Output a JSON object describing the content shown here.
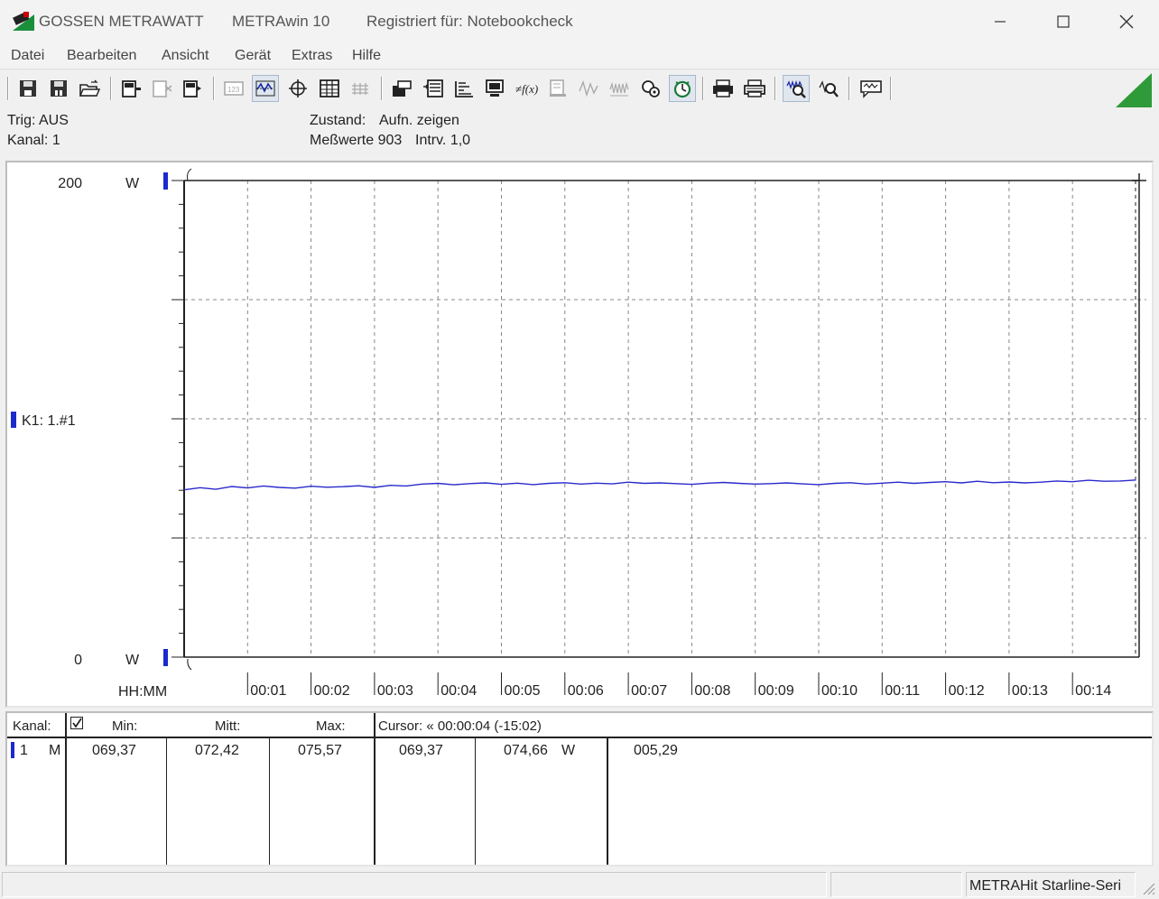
{
  "window": {
    "vendor": "GOSSEN METRAWATT",
    "app": "METRAwin 10",
    "registration": "Registriert für: Notebookcheck"
  },
  "menu": [
    "Datei",
    "Bearbeiten",
    "Ansicht",
    "Gerät",
    "Extras",
    "Hilfe"
  ],
  "status": {
    "trigger": "Trig: AUS",
    "channel": "Kanal: 1",
    "state_label": "Zustand:",
    "state_value": "Aufn. zeigen",
    "measurements": "Meßwerte 903",
    "interval": "Intrv. 1,0"
  },
  "chart_data": {
    "type": "line",
    "y_axis": {
      "max_label": "200",
      "min_label": "0",
      "unit": "W",
      "min": 0,
      "max": 200
    },
    "x_axis": {
      "label": "HH:MM",
      "ticks": [
        "00:01",
        "00:02",
        "00:03",
        "00:04",
        "00:05",
        "00:06",
        "00:07",
        "00:08",
        "00:09",
        "00:10",
        "00:11",
        "00:12",
        "00:13",
        "00:14"
      ],
      "min_minutes": 0,
      "max_minutes": 15.05
    },
    "grid": true,
    "series": [
      {
        "name": "K1: 1.#1",
        "color": "#2a2acc",
        "x_minutes": [
          0,
          0.25,
          0.5,
          0.75,
          1,
          1.25,
          1.5,
          1.75,
          2,
          2.25,
          2.5,
          2.75,
          3,
          3.25,
          3.5,
          3.75,
          4,
          4.25,
          4.5,
          4.75,
          5,
          5.25,
          5.5,
          5.75,
          6,
          6.25,
          6.5,
          6.75,
          7,
          7.25,
          7.5,
          7.75,
          8,
          8.25,
          8.5,
          8.75,
          9,
          9.25,
          9.5,
          9.75,
          10,
          10.25,
          10.5,
          10.75,
          11,
          11.25,
          11.5,
          11.75,
          12,
          12.25,
          12.5,
          12.75,
          13,
          13.25,
          13.5,
          13.75,
          14,
          14.25,
          14.5,
          14.75,
          15
        ],
        "values": [
          70.2,
          71.1,
          70.4,
          71.6,
          71.0,
          71.8,
          71.2,
          70.9,
          71.7,
          71.3,
          71.5,
          71.9,
          71.2,
          72.1,
          71.8,
          72.6,
          72.9,
          72.3,
          72.8,
          73.1,
          72.5,
          73.0,
          72.4,
          72.9,
          73.2,
          72.6,
          73.0,
          72.7,
          73.4,
          72.9,
          73.1,
          72.8,
          72.5,
          73.0,
          73.3,
          72.9,
          72.6,
          72.8,
          73.1,
          72.7,
          72.4,
          72.9,
          73.2,
          72.6,
          73.0,
          73.4,
          72.9,
          73.3,
          73.6,
          73.1,
          73.8,
          73.2,
          73.5,
          73.1,
          73.4,
          73.9,
          73.6,
          74.2,
          73.8,
          73.9,
          74.3
        ]
      }
    ],
    "legend_position": "left"
  },
  "table": {
    "headers": {
      "kanal": "Kanal:",
      "min": "Min:",
      "mitt": "Mitt:",
      "max": "Max:",
      "cursor": "Cursor: « 00:00:04 (-15:02)"
    },
    "row": {
      "channel": "1",
      "mode": "M",
      "min": "069,37",
      "mitt": "072,42",
      "max": "075,57",
      "c1": "069,37",
      "c2": "074,66",
      "unit": "W",
      "c3": "005,29"
    }
  },
  "statusbar": {
    "device": "METRAHit Starline-Seri"
  }
}
